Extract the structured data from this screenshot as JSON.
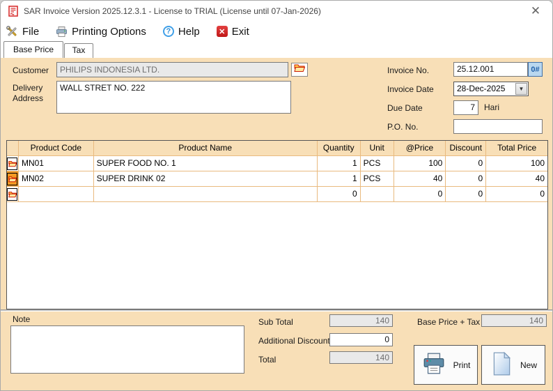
{
  "window": {
    "title": "SAR Invoice Version 2025.12.3.1 - License to TRIAL (License until 07-Jan-2026)",
    "close_glyph": "✕"
  },
  "menu": {
    "file": "File",
    "printing_options": "Printing Options",
    "help": "Help",
    "help_glyph": "?",
    "exit": "Exit",
    "exit_glyph": "✕"
  },
  "tabs": {
    "base_price": "Base Price",
    "tax": "Tax"
  },
  "form": {
    "customer": {
      "label": "Customer",
      "value": "PHILIPS INDONESIA LTD."
    },
    "delivery_address": {
      "label": "Delivery Address",
      "value": "WALL STRET NO. 222"
    },
    "invoice_no": {
      "label": "Invoice No.",
      "value": "25.12.001",
      "button_label": "0#"
    },
    "invoice_date": {
      "label": "Invoice Date",
      "value": "28-Dec-2025",
      "arrow_glyph": "▼"
    },
    "due_date": {
      "label": "Due Date",
      "value": "7",
      "suffix": "Hari"
    },
    "po_no": {
      "label": "P.O. No.",
      "value": ""
    }
  },
  "table": {
    "headers": {
      "code": "Product Code",
      "name": "Product Name",
      "qty": "Quantity",
      "unit": "Unit",
      "price": "@Price",
      "discount": "Discount",
      "total": "Total Price"
    },
    "rows": [
      {
        "code": "MN01",
        "name": "SUPER FOOD NO. 1",
        "qty": "1",
        "unit": "PCS",
        "price": "100",
        "discount": "0",
        "total": "100",
        "selected": false
      },
      {
        "code": "MN02",
        "name": "SUPER DRINK 02",
        "qty": "1",
        "unit": "PCS",
        "price": "40",
        "discount": "0",
        "total": "40",
        "selected": true
      },
      {
        "code": "",
        "name": "",
        "qty": "0",
        "unit": "",
        "price": "0",
        "discount": "0",
        "total": "0",
        "selected": false
      }
    ]
  },
  "footer": {
    "note": {
      "label": "Note",
      "value": ""
    },
    "sub_total": {
      "label": "Sub Total",
      "value": "140"
    },
    "additional_discount": {
      "label": "Additional Discount",
      "value": "0"
    },
    "total": {
      "label": "Total",
      "value": "140"
    },
    "base_price_tax": {
      "label": "Base Price + Tax",
      "value": "140"
    },
    "print_label": "Print",
    "new_label": "New"
  },
  "colors": {
    "content_bg": "#F8DFB7",
    "grid_line": "#E9BA7F",
    "selected_row_cell": "#F59A23",
    "readonly_bg": "#E9E9E9",
    "readonly_text": "#6F6F6F",
    "invoice_btn_bg": "#B9D7EF",
    "invoice_btn_text": "#1F5FA9",
    "exit_red": "#C01818",
    "help_blue": "#41A0E8"
  }
}
